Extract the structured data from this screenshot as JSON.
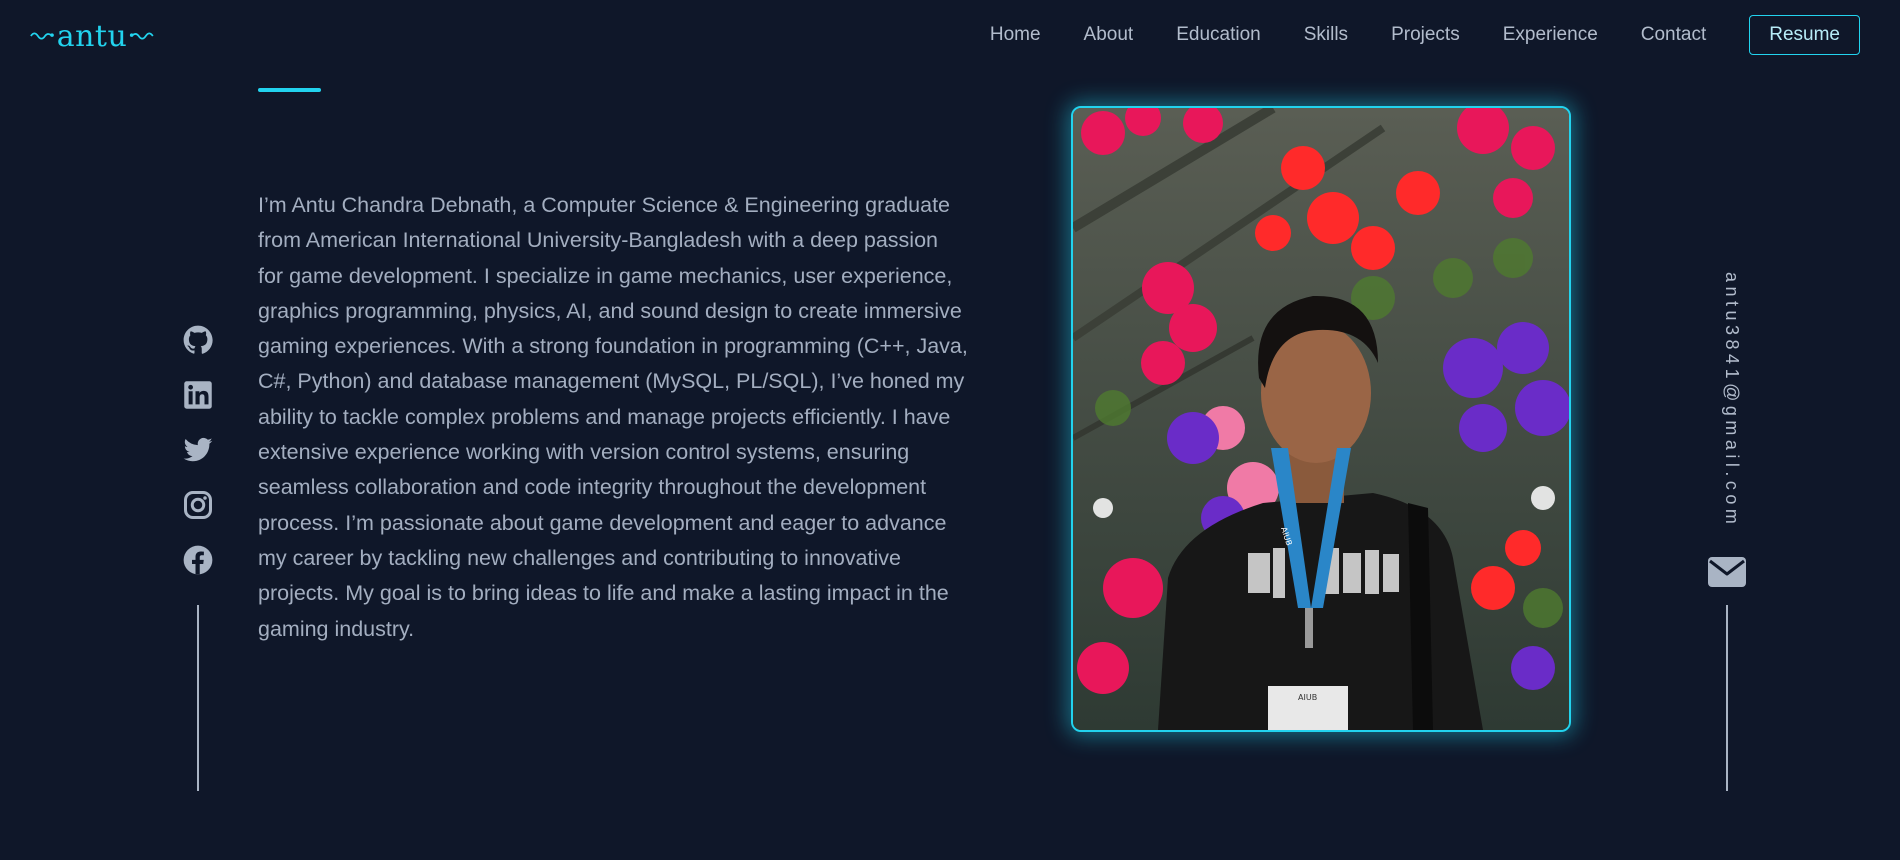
{
  "header": {
    "logo_text": "antu",
    "nav": [
      "Home",
      "About",
      "Education",
      "Skills",
      "Projects",
      "Experience",
      "Contact"
    ],
    "resume_label": "Resume"
  },
  "about": {
    "paragraph": "I’m Antu Chandra Debnath, a Computer Science & Engineering graduate from American International University-Bangladesh with a deep passion for game development. I specialize in game mechanics, user experience, graphics programming, physics, AI, and sound design to create immersive gaming experiences. With a strong foundation in programming (C++, Java, C#, Python) and database management (MySQL, PL/SQL), I’ve honed my ability to tackle complex problems and manage projects efficiently. I have extensive experience working with version control systems, ensuring seamless collaboration and code integrity throughout the development process. I’m passionate about game development and eager to advance my career by tackling new challenges and contributing to innovative projects. My goal is to bring ideas to life and make a lasting impact in the gaming industry."
  },
  "social_icons": [
    "github-icon",
    "linkedin-icon",
    "twitter-icon",
    "instagram-icon",
    "facebook-icon"
  ],
  "email": "antu3841@gmail.com",
  "photo": {
    "lanyard_text": "AIUB",
    "badge_text": "AIUB"
  },
  "colors": {
    "background": "#0f1729",
    "accent": "#22d3ee",
    "text": "#a3aec0"
  }
}
